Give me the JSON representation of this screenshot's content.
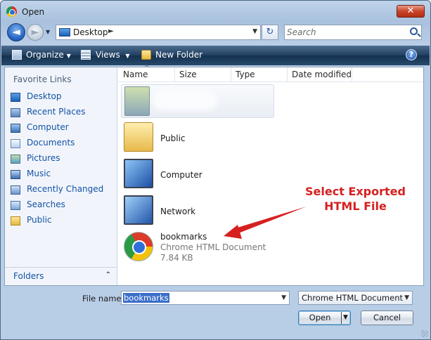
{
  "window": {
    "title": "Open",
    "close_glyph": "✕"
  },
  "nav": {
    "back_glyph": "◄",
    "forward_glyph": "►",
    "history_dropdown_glyph": "▼",
    "address_crumb": "Desktop",
    "crumb_arrow_glyph": "►",
    "address_dropdown_glyph": "▼",
    "refresh_glyph": "↻",
    "search_placeholder": "Search"
  },
  "toolbar": {
    "organize_label": "Organize",
    "views_label": "Views",
    "new_folder_label": "New Folder",
    "dropdown_glyph": "▼",
    "help_glyph": "?"
  },
  "sidebar": {
    "heading": "Favorite Links",
    "items": [
      {
        "label": "Desktop",
        "icon": "desktop-icon"
      },
      {
        "label": "Recent Places",
        "icon": "recent-places-icon"
      },
      {
        "label": "Computer",
        "icon": "computer-icon"
      },
      {
        "label": "Documents",
        "icon": "documents-icon"
      },
      {
        "label": "Pictures",
        "icon": "pictures-icon"
      },
      {
        "label": "Music",
        "icon": "music-icon"
      },
      {
        "label": "Recently Changed",
        "icon": "recently-changed-icon"
      },
      {
        "label": "Searches",
        "icon": "searches-icon"
      },
      {
        "label": "Public",
        "icon": "public-folder-icon"
      }
    ],
    "folders_label": "Folders",
    "folders_chevron": "⌃"
  },
  "columns": [
    "Name",
    "Size",
    "Type",
    "Date modified"
  ],
  "sort_caret": "^",
  "files": [
    {
      "name": "Public",
      "icon": "folder-icon"
    },
    {
      "name": "Computer",
      "icon": "computer-icon"
    },
    {
      "name": "Network",
      "icon": "network-icon"
    },
    {
      "name": "bookmarks",
      "type": "Chrome HTML Document",
      "size": "7.84 KB",
      "icon": "chrome-icon"
    }
  ],
  "annotation": {
    "line1": "Select Exported",
    "line2": "HTML File",
    "color": "#d62020"
  },
  "footer": {
    "file_name_label": "File name:",
    "file_name_value": "bookmarks",
    "file_type_value": "Chrome HTML Document",
    "open_label": "Open",
    "cancel_label": "Cancel",
    "dropdown_glyph": "▼"
  }
}
